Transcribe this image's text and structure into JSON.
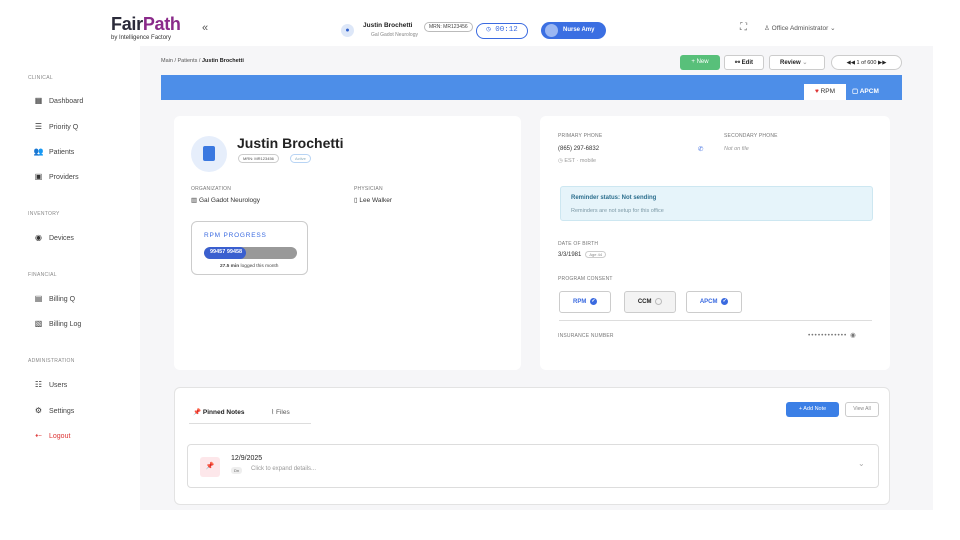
{
  "brand": {
    "fair": "Fair",
    "path": "Path",
    "sub": "by Intelligence Factory",
    "collapse": "«"
  },
  "header": {
    "patient_name": "Justin Brochetti",
    "mrn": "MRN: MR123456",
    "org": "Gal Gadot Neurology",
    "timer": "00:12",
    "nurse": "Nurse Amy",
    "user": "Office Administrator"
  },
  "sidebar": {
    "sections": [
      "CLINICAL",
      "INVENTORY",
      "FINANCIAL",
      "ADMINISTRATION"
    ],
    "items": [
      {
        "label": "Dashboard",
        "icon": "dashboard-icon"
      },
      {
        "label": "Priority Q",
        "icon": "list-icon"
      },
      {
        "label": "Patients",
        "icon": "patients-icon"
      },
      {
        "label": "Providers",
        "icon": "providers-icon"
      },
      {
        "label": "Devices",
        "icon": "device-icon"
      },
      {
        "label": "Billing Q",
        "icon": "billing-icon"
      },
      {
        "label": "Billing Log",
        "icon": "log-icon"
      },
      {
        "label": "Users",
        "icon": "users-icon"
      },
      {
        "label": "Settings",
        "icon": "gear-icon"
      },
      {
        "label": "Logout",
        "icon": "logout-icon"
      }
    ]
  },
  "breadcrumb": {
    "main": "Main",
    "patients": "Patients",
    "current": "Justin Brochetti"
  },
  "toolbar": {
    "new": "New",
    "edit": "Edit",
    "review": "Review",
    "pager": "1 of 600"
  },
  "program_tabs": {
    "rpm": "RPM",
    "apcm": "APCM"
  },
  "profile": {
    "name": "Justin Brochetti",
    "mrn": "MRN: MR123456",
    "status": "Active",
    "org_label": "ORGANIZATION",
    "org": "Gal Gadot Neurology",
    "phys_label": "PHYSICIAN",
    "physician": "Lee Walker"
  },
  "rpm": {
    "title": "RPM PROGRESS",
    "codes": "99457 99458",
    "progress": 0.45,
    "minutes": "27.5 min",
    "logged": "logged this month"
  },
  "contact": {
    "primary_label": "PRIMARY PHONE",
    "primary": "(865) 297-6832",
    "tz": "EST",
    "type": "mobile",
    "secondary_label": "SECONDARY PHONE",
    "secondary": "Not on file",
    "reminder_status": "Reminder status: Not sending",
    "reminder_note": "Reminders are not setup for this office",
    "dob_label": "DATE OF BIRTH",
    "dob": "3/3/1981",
    "age": "Age 44",
    "consent_label": "PROGRAM CONSENT",
    "consent": [
      "RPM",
      "CCM",
      "APCM"
    ],
    "ins_label": "INSURANCE NUMBER",
    "ins": "••••••••••••"
  },
  "notes": {
    "tab_pinned": "Pinned Notes",
    "tab_files": "Files",
    "add": "Add Note",
    "view_all": "View All",
    "date": "12/9/2025",
    "tag": "Dn",
    "hint": "Click to expand details..."
  }
}
